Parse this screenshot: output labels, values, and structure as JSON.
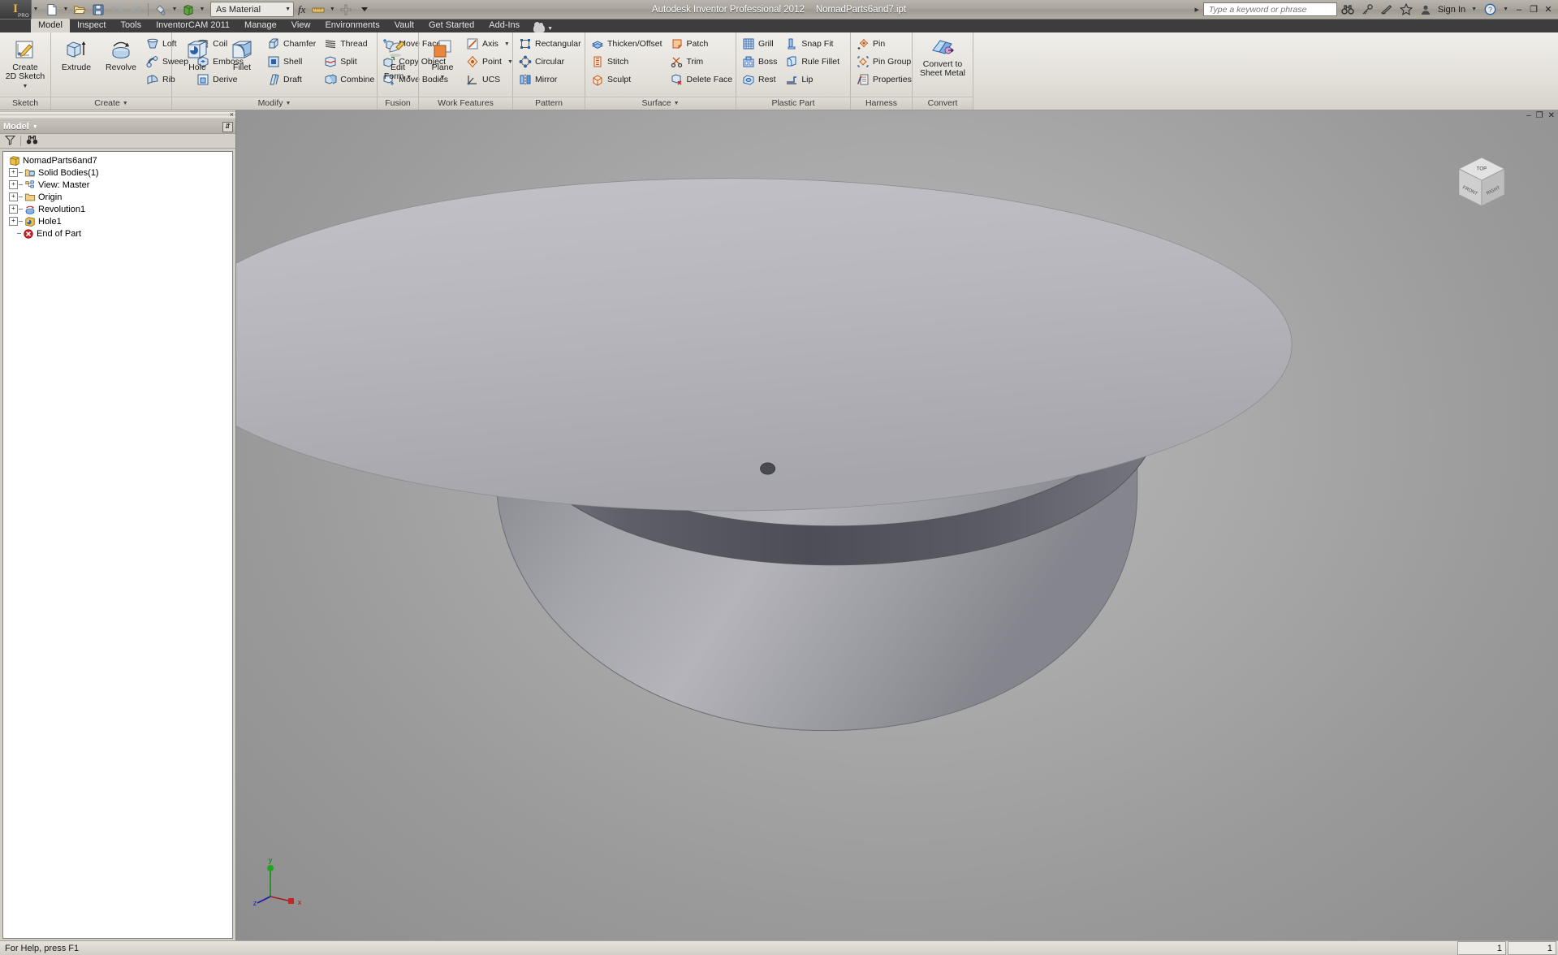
{
  "app": {
    "title": "Autodesk Inventor Professional 2012",
    "filename": "NomadParts6and7.ipt",
    "logo_letter": "I",
    "logo_sub": "PRO"
  },
  "quick_access": {
    "items": [
      {
        "name": "new-file",
        "icon": "new-document-icon",
        "has_dropdown": true
      },
      {
        "name": "open-file",
        "icon": "open-folder-icon",
        "has_dropdown": false
      },
      {
        "name": "save-file",
        "icon": "floppy-save-icon",
        "has_dropdown": false
      },
      {
        "name": "undo",
        "icon": "undo-arrow-icon",
        "has_dropdown": false
      },
      {
        "name": "redo",
        "icon": "redo-arrow-icon",
        "has_dropdown": false
      },
      {
        "name": "appearance",
        "icon": "paint-bucket-icon",
        "has_dropdown": true
      },
      {
        "name": "material",
        "icon": "material-box-icon",
        "has_dropdown": true
      }
    ],
    "material_value": "As Material",
    "fx_label": "fx",
    "extra": [
      {
        "name": "parameters",
        "icon": "ruler-icon",
        "has_dropdown": true
      },
      {
        "name": "add-command",
        "icon": "plus-icon",
        "has_dropdown": false
      },
      {
        "name": "customize-qat",
        "icon": "chevron-down-icon",
        "has_dropdown": false
      }
    ]
  },
  "search": {
    "placeholder": "Type a keyword or phrase",
    "value": ""
  },
  "title_right": {
    "icons": [
      "binoculars-icon",
      "key-icon",
      "satellite-dish-icon",
      "star-favorites-icon",
      "person-icon"
    ],
    "sign_in": "Sign In",
    "help": "?",
    "minimize": "–",
    "restore": "❐",
    "close": "✕"
  },
  "ribbon": {
    "tabs": [
      {
        "label": "Model",
        "active": true
      },
      {
        "label": "Inspect",
        "active": false
      },
      {
        "label": "Tools",
        "active": false
      },
      {
        "label": "InventorCAM 2011",
        "active": false
      },
      {
        "label": "Manage",
        "active": false
      },
      {
        "label": "View",
        "active": false
      },
      {
        "label": "Environments",
        "active": false
      },
      {
        "label": "Vault",
        "active": false
      },
      {
        "label": "Get Started",
        "active": false
      },
      {
        "label": "Add-Ins",
        "active": false
      }
    ],
    "cloud_tab": {
      "name": "autodesk-360-icon",
      "has_dropdown": true
    },
    "panels": [
      {
        "label": "Sketch",
        "has_dropdown": false,
        "big": [
          {
            "label": "Create\n2D Sketch",
            "icon": "sketch-pencil-icon",
            "has_dropdown": true
          }
        ],
        "groups": []
      },
      {
        "label": "Create",
        "has_dropdown": true,
        "big": [
          {
            "label": "Extrude",
            "icon": "extrude-icon",
            "has_dropdown": false
          },
          {
            "label": "Revolve",
            "icon": "revolve-icon",
            "has_dropdown": false
          }
        ],
        "groups": [
          [
            {
              "label": "Loft",
              "icon": "loft-icon"
            },
            {
              "label": "Sweep",
              "icon": "sweep-icon"
            },
            {
              "label": "Rib",
              "icon": "rib-icon"
            }
          ],
          [
            {
              "label": "Coil",
              "icon": "coil-icon"
            },
            {
              "label": "Emboss",
              "icon": "emboss-icon"
            },
            {
              "label": "Derive",
              "icon": "derive-icon"
            }
          ]
        ]
      },
      {
        "label": "Modify",
        "has_dropdown": true,
        "big": [
          {
            "label": "Hole",
            "icon": "hole-icon",
            "has_dropdown": false
          },
          {
            "label": "Fillet",
            "icon": "fillet-icon",
            "has_dropdown": false
          }
        ],
        "groups": [
          [
            {
              "label": "Chamfer",
              "icon": "chamfer-icon"
            },
            {
              "label": "Shell",
              "icon": "shell-icon"
            },
            {
              "label": "Draft",
              "icon": "draft-icon"
            }
          ],
          [
            {
              "label": "Thread",
              "icon": "thread-icon"
            },
            {
              "label": "Split",
              "icon": "split-icon"
            },
            {
              "label": "Combine",
              "icon": "combine-icon"
            }
          ],
          [
            {
              "label": "Move Face",
              "icon": "move-face-icon"
            },
            {
              "label": "Copy Object",
              "icon": "copy-object-icon"
            },
            {
              "label": "Move Bodies",
              "icon": "move-bodies-icon"
            }
          ]
        ]
      },
      {
        "label": "Fusion",
        "has_dropdown": false,
        "big": [
          {
            "label": "Edit\nForm",
            "icon": "edit-form-icon",
            "has_dropdown": true
          }
        ],
        "groups": []
      },
      {
        "label": "Work Features",
        "has_dropdown": false,
        "big": [
          {
            "label": "Plane",
            "icon": "work-plane-icon",
            "has_dropdown": true
          }
        ],
        "groups": [
          [
            {
              "label": "Axis",
              "icon": "work-axis-icon",
              "has_dropdown": true
            },
            {
              "label": "Point",
              "icon": "work-point-icon",
              "has_dropdown": true
            },
            {
              "label": "UCS",
              "icon": "ucs-icon"
            }
          ]
        ]
      },
      {
        "label": "Pattern",
        "has_dropdown": false,
        "big": [],
        "groups": [
          [
            {
              "label": "Rectangular",
              "icon": "rectangular-pattern-icon"
            },
            {
              "label": "Circular",
              "icon": "circular-pattern-icon"
            },
            {
              "label": "Mirror",
              "icon": "mirror-icon"
            }
          ]
        ]
      },
      {
        "label": "Surface",
        "has_dropdown": true,
        "big": [],
        "groups": [
          [
            {
              "label": "Thicken/Offset",
              "icon": "thicken-offset-icon"
            },
            {
              "label": "Stitch",
              "icon": "stitch-icon"
            },
            {
              "label": "Sculpt",
              "icon": "sculpt-icon"
            }
          ],
          [
            {
              "label": "Patch",
              "icon": "patch-icon"
            },
            {
              "label": "Trim",
              "icon": "trim-scissors-icon"
            },
            {
              "label": "Delete Face",
              "icon": "delete-face-icon"
            }
          ]
        ]
      },
      {
        "label": "Plastic Part",
        "has_dropdown": false,
        "big": [],
        "groups": [
          [
            {
              "label": "Grill",
              "icon": "grill-icon"
            },
            {
              "label": "Boss",
              "icon": "boss-icon"
            },
            {
              "label": "Rest",
              "icon": "rest-icon"
            }
          ],
          [
            {
              "label": "Snap Fit",
              "icon": "snap-fit-icon"
            },
            {
              "label": "Rule Fillet",
              "icon": "rule-fillet-icon"
            },
            {
              "label": "Lip",
              "icon": "lip-icon"
            }
          ]
        ]
      },
      {
        "label": "Harness",
        "has_dropdown": false,
        "big": [],
        "groups": [
          [
            {
              "label": "Pin",
              "icon": "pin-icon"
            },
            {
              "label": "Pin Group",
              "icon": "pin-group-icon"
            },
            {
              "label": "Properties",
              "icon": "properties-icon"
            }
          ]
        ]
      },
      {
        "label": "Convert",
        "has_dropdown": false,
        "big": [
          {
            "label": "Convert to\nSheet Metal",
            "icon": "convert-sheet-metal-icon",
            "has_dropdown": false
          }
        ],
        "groups": []
      }
    ]
  },
  "browser": {
    "title": "Model",
    "toolbar": [
      {
        "name": "filter-icon"
      },
      {
        "name": "find-binoculars-icon"
      }
    ],
    "tree": [
      {
        "label": "NomadParts6and7",
        "icon": "part-document-icon",
        "indent": 0,
        "expandable": false,
        "has_line": false
      },
      {
        "label": "Solid Bodies(1)",
        "icon": "solid-bodies-folder-icon",
        "indent": 1,
        "expandable": true,
        "has_line": true
      },
      {
        "label": "View: Master",
        "icon": "view-master-icon",
        "indent": 1,
        "expandable": true,
        "has_line": true
      },
      {
        "label": "Origin",
        "icon": "origin-folder-icon",
        "indent": 1,
        "expandable": true,
        "has_line": true
      },
      {
        "label": "Revolution1",
        "icon": "revolution-feature-icon",
        "indent": 1,
        "expandable": true,
        "has_line": true
      },
      {
        "label": "Hole1",
        "icon": "hole-feature-icon",
        "indent": 1,
        "expandable": true,
        "has_line": true
      },
      {
        "label": "End of Part",
        "icon": "end-of-part-icon",
        "indent": 1,
        "expandable": false,
        "has_line": true
      }
    ]
  },
  "viewport": {
    "viewcube_faces": {
      "top": "TOP",
      "front": "FRONT",
      "right": "RIGHT"
    },
    "axis_labels": {
      "x": "x",
      "y": "y",
      "z": "z"
    },
    "window_buttons": {
      "minimize": "–",
      "restore": "❐",
      "close": "✕"
    },
    "model_description": "revolved conical solid with centre hole"
  },
  "statusbar": {
    "message": "For Help, press F1",
    "cell1": "1",
    "cell2": "1"
  },
  "colors": {
    "accent_orange": "#e8a33d",
    "titlebar": "#a8a49c",
    "ribbon_bg": "#e4e1db",
    "tab_strip": "#3d3d3d",
    "viewport_bg": "#9a9a9a",
    "model_light": "#b9b9bd",
    "model_dark": "#636368",
    "axis_x": "#cc2020",
    "axis_y": "#20a020",
    "axis_z": "#2020cc"
  }
}
